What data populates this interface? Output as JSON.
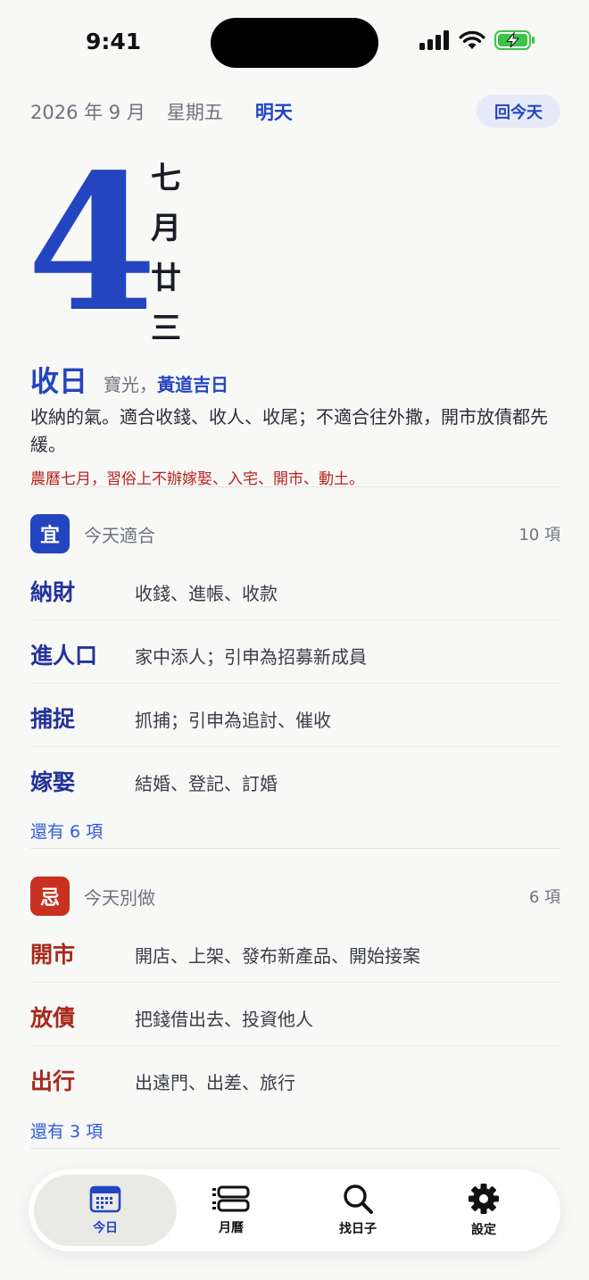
{
  "status": {
    "time": "9:41"
  },
  "header": {
    "date": "2026 年 9 月",
    "weekday": "星期五",
    "relative": "明天",
    "today_button": "回今天"
  },
  "day": {
    "number": "4",
    "lunar": [
      "七",
      "月",
      "廿",
      "三"
    ]
  },
  "officer": {
    "name": "收日",
    "star": "寶光",
    "comma": "，",
    "tag": "黃道吉日",
    "description": "收納的氣。適合收錢、收人、收尾；不適合往外撒，開市放債都先緩。",
    "warning": "農曆七月，習俗上不辦嫁娶、入宅、開市、動土。"
  },
  "good": {
    "badge": "宜",
    "title": "今天適合",
    "count": "10 項",
    "items": [
      {
        "name": "納財",
        "desc": "收錢、進帳、收款"
      },
      {
        "name": "進人口",
        "desc": "家中添人；引申為招募新成員"
      },
      {
        "name": "捕捉",
        "desc": "抓捕；引申為追討、催收"
      },
      {
        "name": "嫁娶",
        "desc": "結婚、登記、訂婚"
      }
    ],
    "more": "還有 6 項"
  },
  "bad": {
    "badge": "忌",
    "title": "今天別做",
    "count": "6 項",
    "items": [
      {
        "name": "開市",
        "desc": "開店、上架、發布新產品、開始接案"
      },
      {
        "name": "放債",
        "desc": "把錢借出去、投資他人"
      },
      {
        "name": "出行",
        "desc": "出遠門、出差、旅行"
      }
    ],
    "more": "還有 3 項"
  },
  "tabs": [
    {
      "label": "今日",
      "icon": "calendar-today-icon",
      "active": true
    },
    {
      "label": "月曆",
      "icon": "month-calendar-icon",
      "active": false
    },
    {
      "label": "找日子",
      "icon": "search-icon",
      "active": false
    },
    {
      "label": "設定",
      "icon": "gear-icon",
      "active": false
    }
  ],
  "colors": {
    "accent": "#2445c0",
    "danger": "#c8311f",
    "background": "#f8f8f7"
  }
}
